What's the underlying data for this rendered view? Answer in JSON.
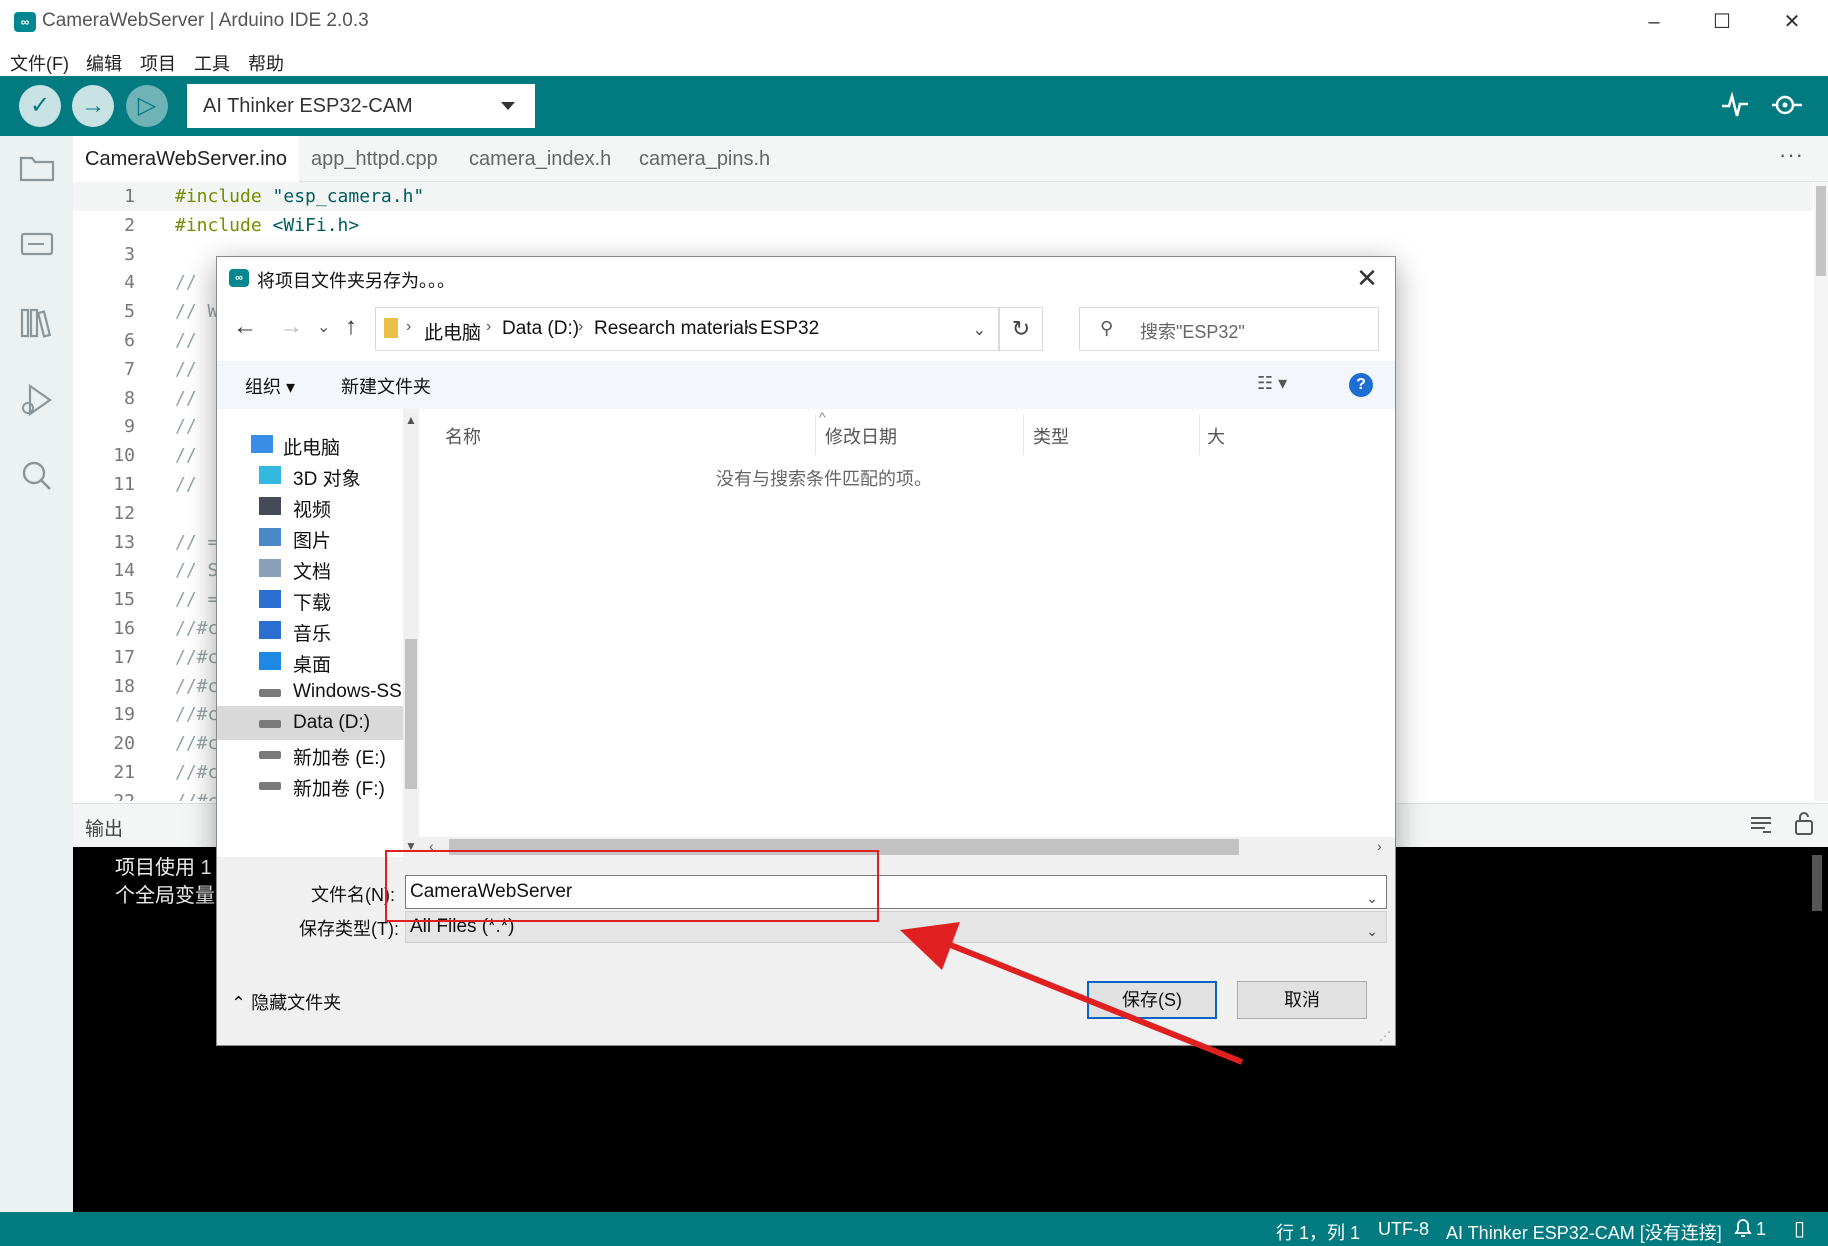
{
  "window": {
    "title": "CameraWebServer | Arduino IDE 2.0.3",
    "app_icon": "∞",
    "controls": [
      "–",
      "☐",
      "✕"
    ]
  },
  "menu": [
    "文件(F)",
    "编辑",
    "项目",
    "工具",
    "帮助"
  ],
  "toolbar": {
    "verify_icon": "✓",
    "upload_icon": "→",
    "debug_icon": "▷",
    "board": "AI Thinker ESP32-CAM",
    "serial_plotter_icon": "serial-plotter-icon",
    "serial_monitor_icon": "serial-monitor-icon"
  },
  "tabs": [
    "CameraWebServer.ino",
    "app_httpd.cpp",
    "camera_index.h",
    "camera_pins.h"
  ],
  "tabs_more": "···",
  "editor": {
    "lines": [
      {
        "n": "1",
        "a": "#include",
        "b": " \"esp_camera.h\""
      },
      {
        "n": "2",
        "a": "#include",
        "b": " <WiFi.h>"
      },
      {
        "n": "3",
        "a": "",
        "b": ""
      },
      {
        "n": "4",
        "a": "",
        "b": "//"
      },
      {
        "n": "5",
        "a": "",
        "b": "// W"
      },
      {
        "n": "6",
        "a": "",
        "b": "//"
      },
      {
        "n": "7",
        "a": "",
        "b": "//"
      },
      {
        "n": "8",
        "a": "",
        "b": "//"
      },
      {
        "n": "9",
        "a": "",
        "b": "//"
      },
      {
        "n": "10",
        "a": "",
        "b": "//"
      },
      {
        "n": "11",
        "a": "",
        "b": "//"
      },
      {
        "n": "12",
        "a": "",
        "b": ""
      },
      {
        "n": "13",
        "a": "",
        "b": "// ="
      },
      {
        "n": "14",
        "a": "",
        "b": "// S"
      },
      {
        "n": "15",
        "a": "",
        "b": "// ="
      },
      {
        "n": "16",
        "a": "",
        "b": "//#c"
      },
      {
        "n": "17",
        "a": "",
        "b": "//#c"
      },
      {
        "n": "18",
        "a": "",
        "b": "//#c"
      },
      {
        "n": "19",
        "a": "",
        "b": "//#c"
      },
      {
        "n": "20",
        "a": "",
        "b": "//#c"
      },
      {
        "n": "21",
        "a": "",
        "b": "//#c"
      },
      {
        "n": "22",
        "a": "",
        "b": "//#c"
      }
    ]
  },
  "output": {
    "title": "输出",
    "line1": "项目使用 1",
    "line2": "个全局变量"
  },
  "statusbar": {
    "position": "行 1，列 1",
    "encoding": "UTF-8",
    "board": "AI Thinker ESP32-CAM [没有连接]",
    "notifications": "1"
  },
  "dialog": {
    "title": "将项目文件夹另存为。。。",
    "address": [
      "此电脑",
      "Data (D:)",
      "Research materials",
      "ESP32"
    ],
    "search_placeholder": "搜索\"ESP32\"",
    "organize": "组织 ▾",
    "new_folder": "新建文件夹",
    "nav_items": [
      {
        "label": "此电脑",
        "icon": "computer-icon",
        "color": "#3a8ee6"
      },
      {
        "label": "3D 对象",
        "icon": "3d-objects-icon",
        "color": "#35b8e0"
      },
      {
        "label": "视频",
        "icon": "video-icon",
        "color": "#444a58"
      },
      {
        "label": "图片",
        "icon": "pictures-icon",
        "color": "#4a88c8"
      },
      {
        "label": "文档",
        "icon": "documents-icon",
        "color": "#8a9fb8"
      },
      {
        "label": "下载",
        "icon": "downloads-icon",
        "color": "#2a6fd0"
      },
      {
        "label": "音乐",
        "icon": "music-icon",
        "color": "#2a6fd0"
      },
      {
        "label": "桌面",
        "icon": "desktop-icon",
        "color": "#1e88e5"
      },
      {
        "label": "Windows-SSD (",
        "icon": "drive-icon",
        "color": "#7a7a7a"
      },
      {
        "label": "Data (D:)",
        "icon": "drive-icon",
        "color": "#7a7a7a"
      },
      {
        "label": "新加卷 (E:)",
        "icon": "drive-icon",
        "color": "#7a7a7a"
      },
      {
        "label": "新加卷 (F:)",
        "icon": "drive-icon",
        "color": "#7a7a7a"
      }
    ],
    "selected_nav": "Data (D:)",
    "columns": [
      "名称",
      "修改日期",
      "类型",
      "大小"
    ],
    "empty_message": "没有与搜索条件匹配的项。",
    "filename_label": "文件名(N):",
    "filename_value": "CameraWebServer",
    "filetype_label": "保存类型(T):",
    "filetype_value": "All Files (*.*)",
    "hide_folders": "隐藏文件夹",
    "save": "保存(S)",
    "cancel": "取消",
    "help": "?"
  },
  "colors": {
    "accent": "#017a80",
    "annotation": "#e02020"
  }
}
